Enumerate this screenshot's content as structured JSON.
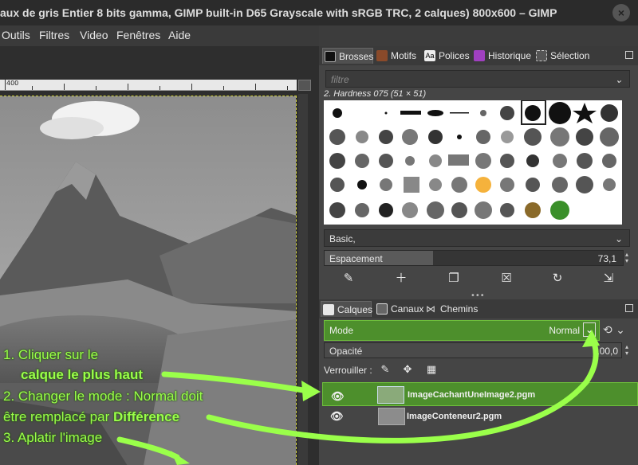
{
  "window": {
    "title": "aux de gris Entier 8 bits gamma, GIMP built-in D65 Grayscale with sRGB TRC, 2 calques) 800x600 – GIMP",
    "close_glyph": "×"
  },
  "menubar": [
    "Outils",
    "Filtres",
    "Video",
    "Fenêtres",
    "Aide"
  ],
  "ruler": {
    "label": "400"
  },
  "brushes_panel": {
    "tabs": [
      "Brosses",
      "Motifs",
      "Polices",
      "Historique",
      "Sélection"
    ],
    "filter_placeholder": "filtre",
    "current_brush": "2. Hardness 075 (51 × 51)",
    "preset": "Basic,",
    "spacing_label": "Espacement",
    "spacing_value": "73,1"
  },
  "layers_panel": {
    "tabs": [
      "Calques",
      "Canaux",
      "Chemins"
    ],
    "mode_label": "Mode",
    "mode_value": "Normal",
    "opacity_label": "Opacité",
    "opacity_value": "100,0",
    "lock_label": "Verrouiller :",
    "layers": [
      {
        "name": "ImageCachantUneImage2.pgm",
        "selected": true
      },
      {
        "name": "ImageConteneur2.pgm",
        "selected": false
      }
    ]
  },
  "annotations": {
    "step1_line1": "1. Cliquer sur le",
    "step1_line2": "calque le plus haut",
    "step2_line1": "2. Changer le mode : Normal doit",
    "step2_line2_prefix": "être remplacé par ",
    "step2_line2_bold": "Différence",
    "step3": "3. Aplatir l'image"
  },
  "colors": {
    "annotation_green": "#9aff4a",
    "highlight_green": "#4d8f2c",
    "canvas_border": "#cfcf3a"
  }
}
